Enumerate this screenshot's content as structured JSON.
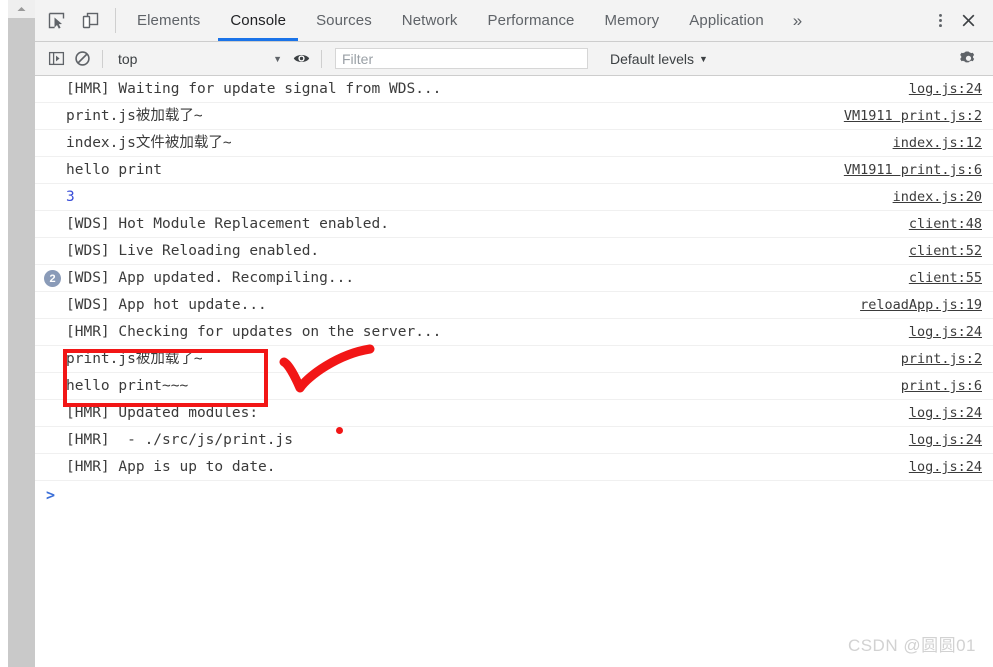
{
  "tabbar": {
    "icons": [
      {
        "name": "inspect-element-icon",
        "label": "Inspect element"
      },
      {
        "name": "device-toolbar-icon",
        "label": "Toggle device toolbar"
      }
    ],
    "tabs": [
      {
        "label": "Elements",
        "active": false
      },
      {
        "label": "Console",
        "active": true
      },
      {
        "label": "Sources",
        "active": false
      },
      {
        "label": "Network",
        "active": false
      },
      {
        "label": "Performance",
        "active": false
      },
      {
        "label": "Memory",
        "active": false
      },
      {
        "label": "Application",
        "active": false
      }
    ],
    "overflow_label": "»",
    "more_options_label": "⋮",
    "close_label": "✕"
  },
  "filterbar": {
    "sidebar_toggle_name": "console-sidebar-icon",
    "clear_console_name": "clear-console-icon",
    "context": "top",
    "context_caret": "▼",
    "eye_icon_name": "live-expression-eye-icon",
    "filter_placeholder": "Filter",
    "filter_value": "",
    "levels_label": "Default levels",
    "levels_caret": "▼",
    "settings_name": "console-settings-gear-icon"
  },
  "console": {
    "rows": [
      {
        "badge": "",
        "text": "[HMR] Waiting for update signal from WDS...",
        "source": "log.js:24",
        "numeric": false
      },
      {
        "badge": "",
        "text": "print.js被加载了~",
        "source": "VM1911 print.js:2",
        "numeric": false
      },
      {
        "badge": "",
        "text": "index.js文件被加载了~",
        "source": "index.js:12",
        "numeric": false
      },
      {
        "badge": "",
        "text": "hello print",
        "source": "VM1911 print.js:6",
        "numeric": false
      },
      {
        "badge": "",
        "text": "3",
        "source": "index.js:20",
        "numeric": true
      },
      {
        "badge": "",
        "text": "[WDS] Hot Module Replacement enabled.",
        "source": "client:48",
        "numeric": false
      },
      {
        "badge": "",
        "text": "[WDS] Live Reloading enabled.",
        "source": "client:52",
        "numeric": false
      },
      {
        "badge": "2",
        "text": "[WDS] App updated. Recompiling...",
        "source": "client:55",
        "numeric": false
      },
      {
        "badge": "",
        "text": "[WDS] App hot update...",
        "source": "reloadApp.js:19",
        "numeric": false
      },
      {
        "badge": "",
        "text": "[HMR] Checking for updates on the server...",
        "source": "log.js:24",
        "numeric": false
      },
      {
        "badge": "",
        "text": "print.js被加载了~",
        "source": "print.js:2",
        "numeric": false
      },
      {
        "badge": "",
        "text": "hello print~~~",
        "source": "print.js:6",
        "numeric": false
      },
      {
        "badge": "",
        "text": "[HMR] Updated modules:",
        "source": "log.js:24",
        "numeric": false
      },
      {
        "badge": "",
        "text": "[HMR]  - ./src/js/print.js",
        "source": "log.js:24",
        "numeric": false
      },
      {
        "badge": "",
        "text": "[HMR] App is up to date.",
        "source": "log.js:24",
        "numeric": false
      }
    ],
    "prompt_caret": ">"
  },
  "annotations": {
    "box_name": "red-highlight-box",
    "check_name": "red-checkmark-annotation",
    "dot_name": "red-dot-annotation",
    "color": "#f21616"
  },
  "watermark": {
    "text": "CSDN @圆圆01"
  },
  "colors": {
    "accent": "#1a73e8",
    "toolbar_bg": "#f3f3f3",
    "badge_bg": "#8a9bb8",
    "annotation_red": "#f21616",
    "number_blue": "#3b4fd8"
  }
}
